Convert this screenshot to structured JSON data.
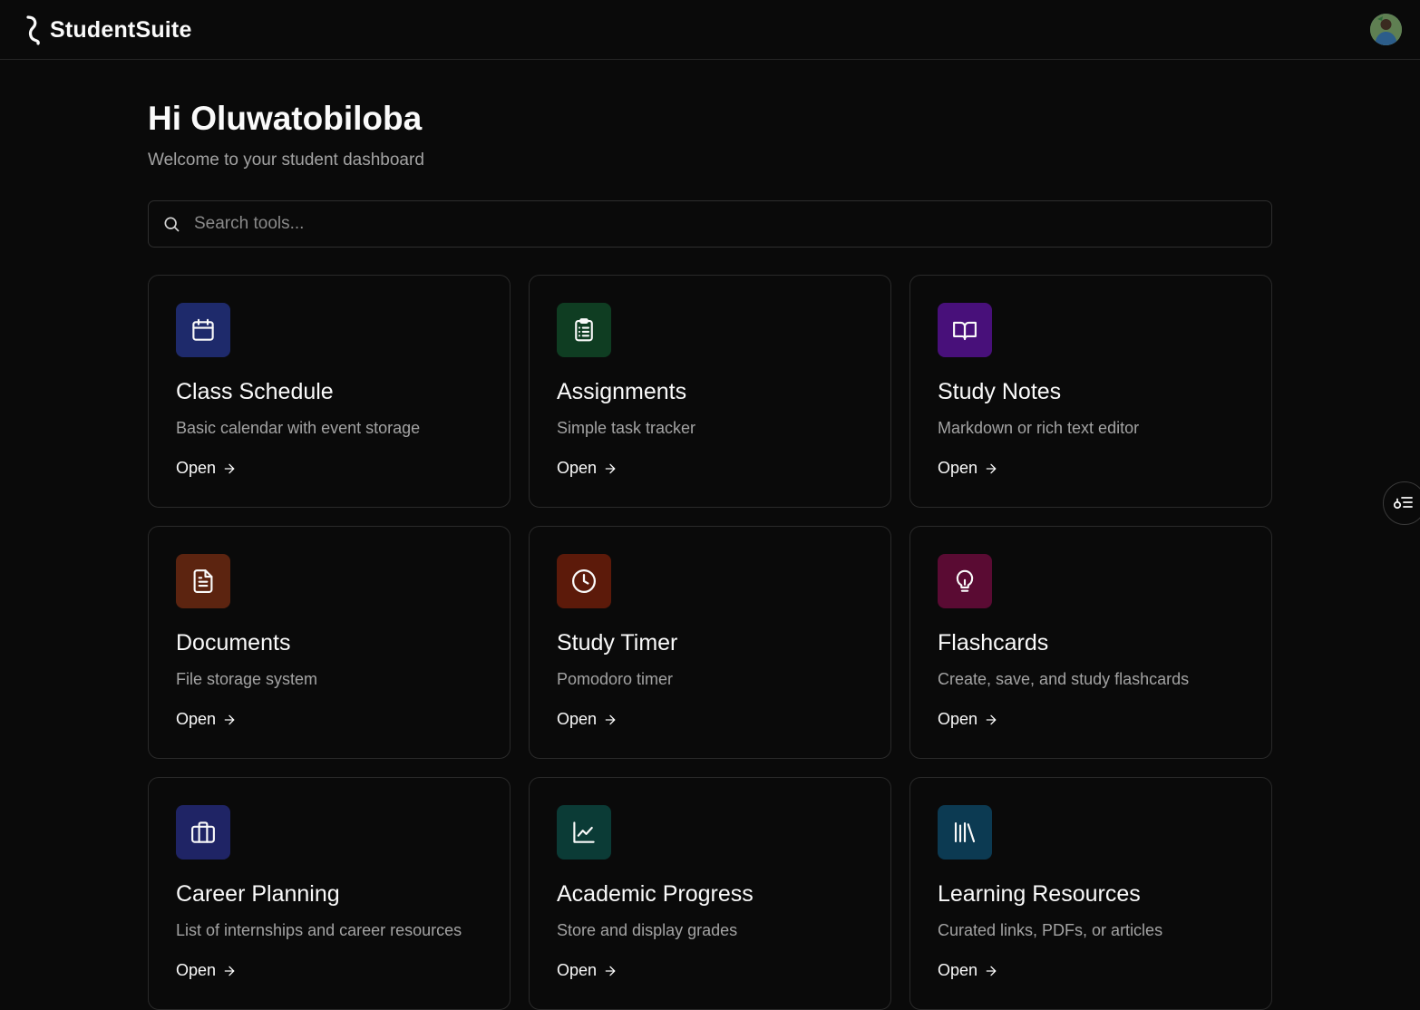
{
  "app": {
    "name": "StudentSuite",
    "logo_icon": "wave-logo-icon"
  },
  "header": {
    "avatar_icon": "user-avatar"
  },
  "dashboard": {
    "greeting": "Hi Oluwatobiloba",
    "subtitle": "Welcome to your student dashboard"
  },
  "search": {
    "placeholder": "Search tools...",
    "value": "",
    "icon": "search-icon"
  },
  "cards": [
    {
      "title": "Class Schedule",
      "description": "Basic calendar with event storage",
      "action": "Open",
      "icon": "calendar-icon",
      "color": "#1e2a6b"
    },
    {
      "title": "Assignments",
      "description": "Simple task tracker",
      "action": "Open",
      "icon": "clipboard-list-icon",
      "color": "#0f3d22"
    },
    {
      "title": "Study Notes",
      "description": "Markdown or rich text editor",
      "action": "Open",
      "icon": "book-open-icon",
      "color": "#48107a"
    },
    {
      "title": "Documents",
      "description": "File storage system",
      "action": "Open",
      "icon": "file-text-icon",
      "color": "#5c2410"
    },
    {
      "title": "Study Timer",
      "description": "Pomodoro timer",
      "action": "Open",
      "icon": "clock-icon",
      "color": "#5c1a0a"
    },
    {
      "title": "Flashcards",
      "description": "Create, save, and study flashcards",
      "action": "Open",
      "icon": "lightbulb-icon",
      "color": "#5a0b33"
    },
    {
      "title": "Career Planning",
      "description": "List of internships and career resources",
      "action": "Open",
      "icon": "briefcase-icon",
      "color": "#1f2465"
    },
    {
      "title": "Academic Progress",
      "description": "Store and display grades",
      "action": "Open",
      "icon": "line-chart-icon",
      "color": "#0b3b36"
    },
    {
      "title": "Learning Resources",
      "description": "Curated links, PDFs, or articles",
      "action": "Open",
      "icon": "library-icon",
      "color": "#0c3a52"
    }
  ],
  "side_widget": {
    "icon": "list-settings-icon"
  },
  "colors": {
    "background": "#0a0a0a",
    "card_border": "#2a2a2a",
    "text": "#fafafa",
    "muted_text": "#a3a3a3"
  }
}
